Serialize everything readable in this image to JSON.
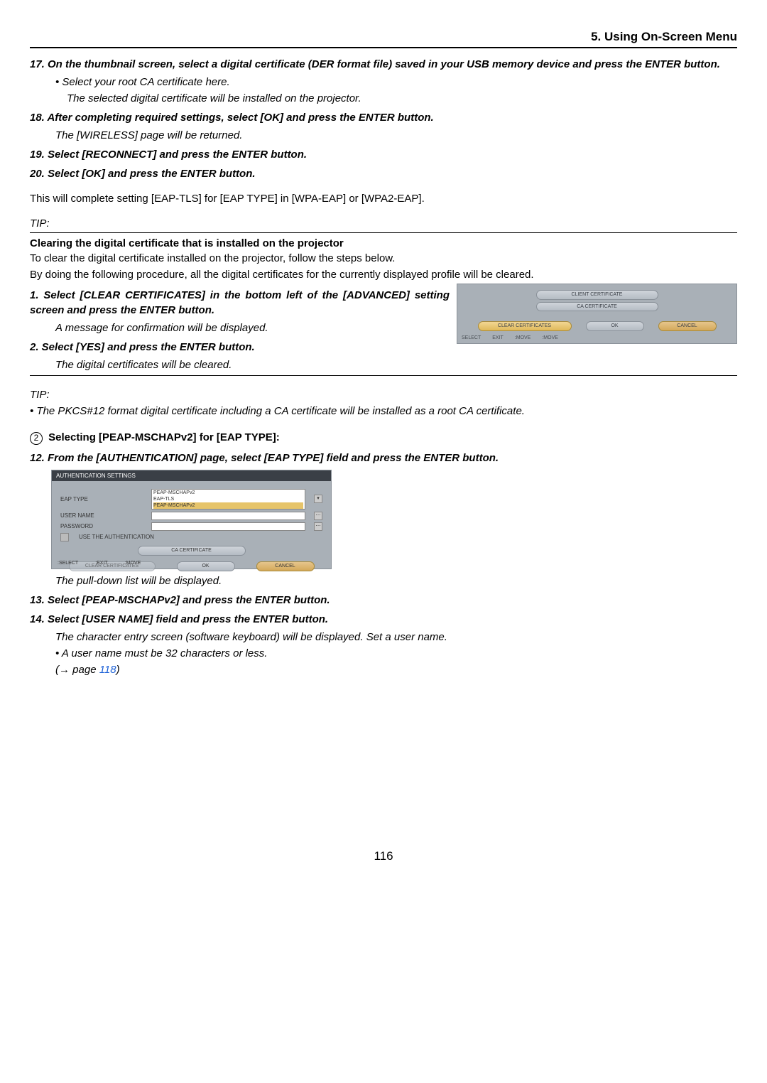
{
  "header": {
    "section": "5. Using On-Screen Menu"
  },
  "steps": {
    "s17": "17.\tOn the thumbnail screen, select a digital certificate (DER format file) saved in your USB memory device and press the ENTER button.",
    "s17_b1": "Select your root CA certificate here.",
    "s17_b2": "The selected digital certificate will be installed on the projector.",
    "s18": "18.\tAfter completing required settings, select [OK] and press the ENTER button.",
    "s18_i": "The [WIRELESS] page will be returned.",
    "s19": "19.\tSelect [RECONNECT] and press the ENTER button.",
    "s20": "20.\tSelect [OK] and press the ENTER button."
  },
  "plain1": "This will complete setting [EAP-TLS] for [EAP TYPE] in [WPA-EAP] or [WPA2-EAP].",
  "tip1": {
    "label": "TIP:"
  },
  "clearing": {
    "title": "Clearing the digital certificate that is installed on the projector",
    "l1": "To clear the digital certificate installed on the projector, follow the steps below.",
    "l2": "By doing the following procedure, all the digital certificates for the currently displayed profile will be cleared.",
    "s1": "1.\tSelect [CLEAR CERTIFICATES] in the bottom left of the [ADVANCED] setting screen and press the ENTER button.",
    "s1_i": "A message for confirmation will be displayed.",
    "s2": "2.\tSelect [YES] and press the ENTER button.",
    "s2_i": "The digital certificates will be cleared."
  },
  "shot1": {
    "client_cert": "CLIENT CERTIFICATE",
    "ca_cert": "CA CERTIFICATE",
    "clear": "CLEAR CERTIFICATES",
    "ok": "OK",
    "cancel": "CANCEL",
    "select": "SELECT",
    "exit": "EXIT",
    "move1": ":MOVE",
    "move2": ":MOVE"
  },
  "tip2": {
    "label": "TIP:",
    "bullet": "•  The PKCS#12 format digital certificate including a CA certificate will be installed as a root CA certificate."
  },
  "sectionB": {
    "num": "2",
    "title": " Selecting [PEAP-MSCHAPv2] for [EAP TYPE]:",
    "s12": "12.\tFrom the [AUTHENTICATION] page, select [EAP TYPE] field and press the ENTER button."
  },
  "shot2": {
    "titlebar": "AUTHENTICATION SETTINGS",
    "eap_type": "EAP TYPE",
    "user_name": "USER NAME",
    "password": "PASSWORD",
    "use_auth": "USE THE AUTHENTICATION",
    "opt1": "PEAP-MSCHAPv2",
    "opt2": "EAP-TLS",
    "opt3": "PEAP-MSCHAPv2",
    "ca_cert": "CA CERTIFICATE",
    "clear": "CLEAR CERTIFICATES",
    "ok": "OK",
    "cancel": "CANCEL",
    "select": ":SELECT",
    "exit": ":EXIT",
    "move": ":MOVE"
  },
  "afterShot2": {
    "i1": "The pull-down list will be displayed.",
    "s13": "13.\tSelect [PEAP-MSCHAPv2] and press the ENTER button.",
    "s14": "14.\tSelect [USER NAME] field and press the ENTER button.",
    "s14_i": "The character entry screen (software keyboard) will be displayed. Set a user name.",
    "s14_b": "A user name must be 32 characters or less.",
    "pageref_pre": "(→ page ",
    "pageref_num": "118",
    "pageref_post": ")"
  },
  "pagenum": "116"
}
